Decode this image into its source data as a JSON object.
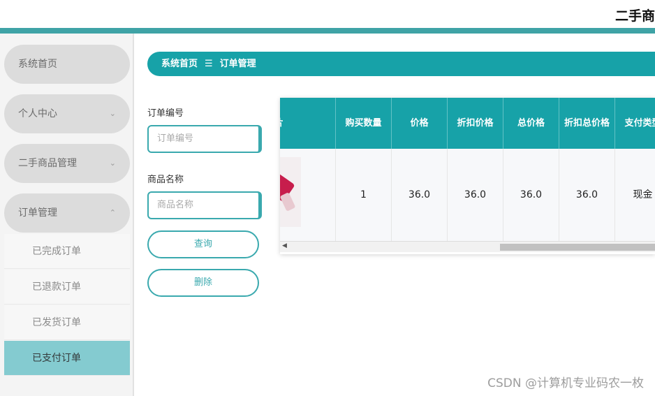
{
  "header": {
    "title": "二手商"
  },
  "sidebar": {
    "items": [
      {
        "label": "系统首页"
      },
      {
        "label": "个人中心",
        "chevron": "⌄"
      },
      {
        "label": "二手商品管理",
        "chevron": "⌄"
      },
      {
        "label": "订单管理",
        "chevron": "⌃"
      }
    ],
    "sub_items": [
      {
        "label": "已完成订单"
      },
      {
        "label": "已退款订单"
      },
      {
        "label": "已发货订单"
      },
      {
        "label": "已支付订单",
        "active": true
      }
    ]
  },
  "breadcrumb": {
    "home": "系统首页",
    "separator": "☰",
    "current": "订单管理"
  },
  "search": {
    "order_no_label": "订单编号",
    "order_no_placeholder": "订单编号",
    "product_name_label": "商品名称",
    "product_name_placeholder": "商品名称",
    "query_button": "查询",
    "delete_button": "删除"
  },
  "table": {
    "partial_header": "片",
    "headers": [
      "购买数量",
      "价格",
      "折扣价格",
      "总价格",
      "折扣总价格",
      "支付类型"
    ],
    "row": [
      "1",
      "36.0",
      "36.0",
      "36.0",
      "36.0",
      "现金"
    ]
  },
  "watermark": "CSDN @计算机专业码农一枚",
  "colors": {
    "accent": "#17a2a8",
    "active_sub": "#84cbd0",
    "border": "#3aa9ae"
  }
}
